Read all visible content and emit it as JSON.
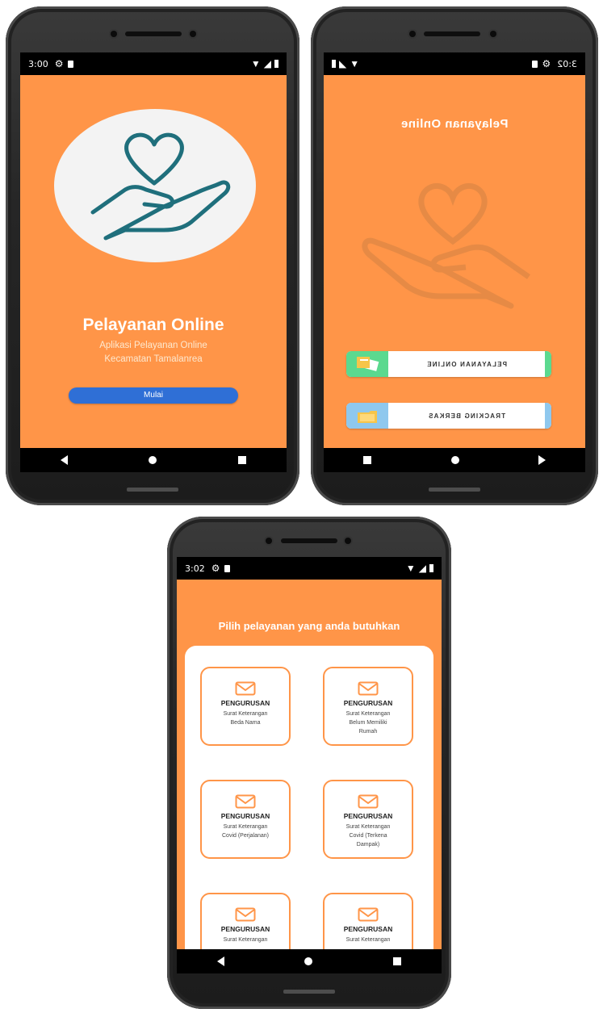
{
  "screens": [
    {
      "status": {
        "time": "3:00"
      },
      "title": "Pelayanan Online",
      "subtitle_line1": "Aplikasi Pelayanan Online",
      "subtitle_line2": "Kecamatan Tamalanrea",
      "start_button": "Mulai"
    },
    {
      "status": {
        "time": "3:02"
      },
      "title": "Pelayanan Online",
      "menu": [
        {
          "label": "PELAYANAN ONLINE",
          "icon": "documents-icon",
          "accent": "#5bd98f"
        },
        {
          "label": "TRACKING BERKAS",
          "icon": "folder-icon",
          "accent": "#8fc8ee"
        }
      ]
    },
    {
      "status": {
        "time": "3:02"
      },
      "title": "Pilih pelayanan yang anda butuhkan",
      "cards": [
        {
          "head": "PENGURUSAN",
          "line1": "Surat Keterangan",
          "line2": "Beda Nama",
          "line3": ""
        },
        {
          "head": "PENGURUSAN",
          "line1": "Surat Keterangan",
          "line2": "Belum Memiliki",
          "line3": "Rumah"
        },
        {
          "head": "PENGURUSAN",
          "line1": "Surat Keterangan",
          "line2": "Covid (Perjalanan)",
          "line3": ""
        },
        {
          "head": "PENGURUSAN",
          "line1": "Surat Keterangan",
          "line2": "Covid (Terkena",
          "line3": "Dampak)"
        },
        {
          "head": "PENGURUSAN",
          "line1": "Surat Keterangan",
          "line2": "",
          "line3": ""
        },
        {
          "head": "PENGURUSAN",
          "line1": "Surat Keterangan",
          "line2": "",
          "line3": ""
        }
      ]
    }
  ],
  "colors": {
    "accent": "#ff9548",
    "button": "#2f6fd6",
    "heart": "#1f6f7c"
  }
}
